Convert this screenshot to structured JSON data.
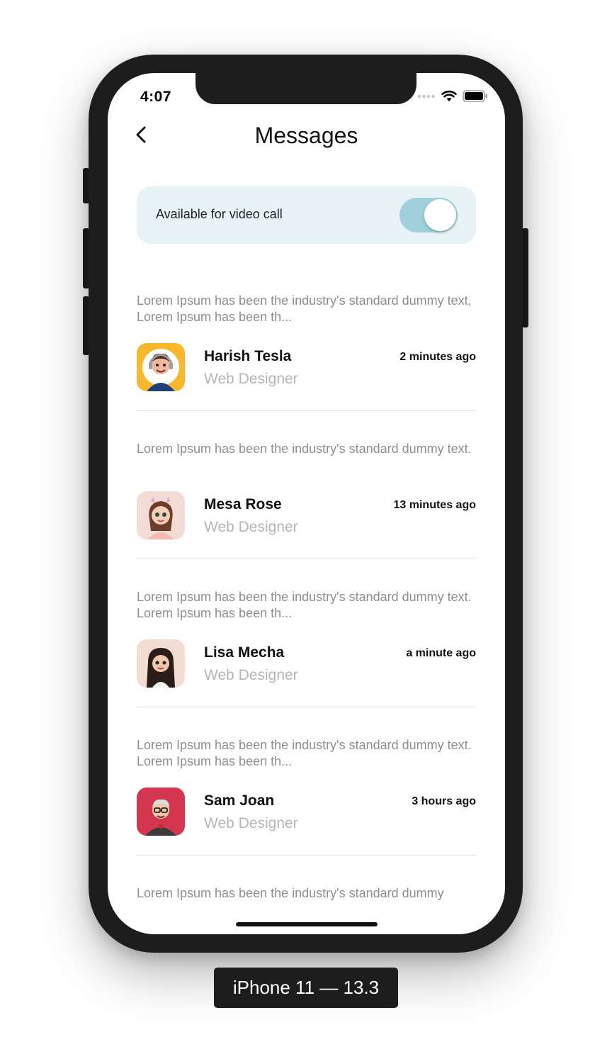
{
  "status_bar": {
    "time": "4:07",
    "icons": [
      "signal-dots-icon",
      "wifi-icon",
      "battery-icon"
    ]
  },
  "nav": {
    "title": "Messages",
    "back_icon": "chevron-left-icon"
  },
  "video_call": {
    "label": "Available for video call",
    "enabled": true,
    "toggle_color": "#9fd0db",
    "card_bg": "#e7f3f7"
  },
  "messages": [
    {
      "preview": "Lorem Ipsum has been the industry's standard dummy text, Lorem Ipsum has been th...",
      "name": "Harish Tesla",
      "role": "Web Designer",
      "time": "2 minutes ago",
      "avatar": "man-headphones-avatar"
    },
    {
      "preview": "Lorem Ipsum has been the industry's standard dummy text.",
      "name": "Mesa Rose",
      "role": "Web Designer",
      "time": "13 minutes ago",
      "avatar": "girl-avatar"
    },
    {
      "preview": "Lorem Ipsum has been the industry's standard dummy text. Lorem Ipsum has been th...",
      "name": "Lisa Mecha",
      "role": "Web Designer",
      "time": "a minute ago",
      "avatar": "woman-avatar"
    },
    {
      "preview": "Lorem Ipsum has been the industry's standard dummy text. Lorem Ipsum has been th...",
      "name": "Sam Joan",
      "role": "Web Designer",
      "time": "3 hours ago",
      "avatar": "man-glasses-avatar"
    },
    {
      "preview": "Lorem Ipsum has been the industry's standard dummy"
    }
  ],
  "device_caption": "iPhone 11 — 13.3"
}
